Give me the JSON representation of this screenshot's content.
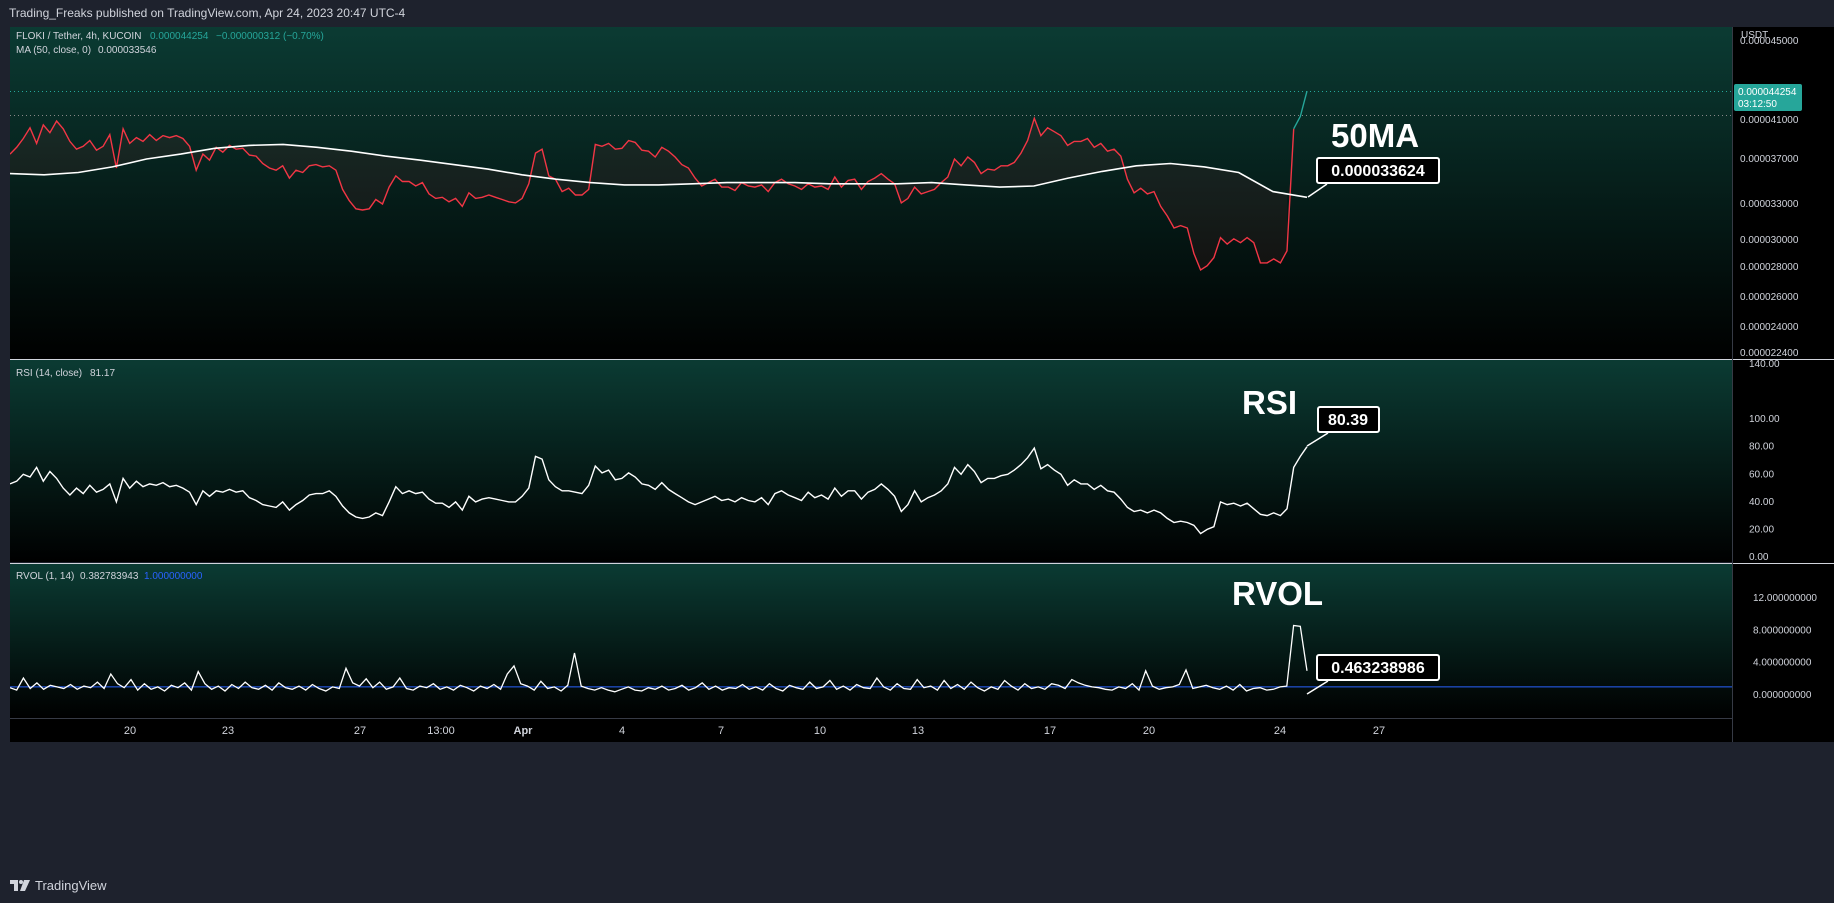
{
  "header": {
    "publisher": "Trading_Freaks published on TradingView.com, Apr 24, 2023 20:47 UTC-4"
  },
  "footer": {
    "brand": "TradingView"
  },
  "price_axis_unit": "USDT",
  "price_pane": {
    "symbol": "FLOKI / Tether, 4h, KUCOIN",
    "last": "0.000044254",
    "change": "−0.000000312 (−0.70%)",
    "ma_title": "MA (50, close, 0)",
    "ma_value": "0.000033546",
    "annotation_label": "50MA",
    "annotation_value": "0.000033624",
    "last_price_tag": "0.000044254",
    "countdown_tag": "03:12:50",
    "axis_ticks": [
      "0.000045000",
      "0.000041000",
      "0.000037000",
      "0.000033000",
      "0.000030000",
      "0.000028000",
      "0.000026000",
      "0.000024000",
      "0.000022400"
    ]
  },
  "rsi_pane": {
    "title": "RSI (14, close)",
    "value": "81.17",
    "annotation_label": "RSI",
    "annotation_value": "80.39",
    "axis_ticks": [
      "140.00",
      "100.00",
      "80.00",
      "60.00",
      "40.00",
      "20.00",
      "0.00"
    ]
  },
  "rvol_pane": {
    "title": "RVOL (1, 14)",
    "value": "0.382783943",
    "value2": "1.000000000",
    "annotation_label": "RVOL",
    "annotation_value": "0.463238986",
    "axis_ticks": [
      "12.000000000",
      "8.000000000",
      "4.000000000",
      "0.000000000"
    ]
  },
  "time_axis": [
    "20",
    "23",
    "27",
    "13:00",
    "Apr",
    "4",
    "7",
    "10",
    "13",
    "17",
    "20",
    "24",
    "27"
  ],
  "colors": {
    "down": "#f23645",
    "up": "#26a69a",
    "ma": "#ffffff",
    "rsi": "#ffffff",
    "rvol": "#ffffff",
    "rvol_baseline": "#2962ff",
    "bg_top": "#0b3b33",
    "bg_bottom": "#000000"
  },
  "chart_data": [
    {
      "type": "line",
      "title": "FLOKI / Tether, 4h, KUCOIN",
      "ylim": [
        2.24e-05,
        5.05e-05
      ],
      "series": [
        {
          "name": "FLOKI / Tether",
          "values": [
            3.75e-05,
            3.82e-05,
            3.91e-05,
            4.02e-05,
            3.86e-05,
            4.05e-05,
            3.97e-05,
            4.09e-05,
            4.01e-05,
            3.88e-05,
            3.8e-05,
            3.83e-05,
            3.89e-05,
            3.79e-05,
            3.83e-05,
            3.95e-05,
            3.62e-05,
            4.01e-05,
            3.86e-05,
            3.92e-05,
            3.88e-05,
            3.95e-05,
            3.89e-05,
            3.94e-05,
            3.92e-05,
            3.94e-05,
            3.91e-05,
            3.83e-05,
            3.6e-05,
            3.75e-05,
            3.69e-05,
            3.82e-05,
            3.77e-05,
            3.84e-05,
            3.8e-05,
            3.81e-05,
            3.74e-05,
            3.73e-05,
            3.66e-05,
            3.62e-05,
            3.6e-05,
            3.64e-05,
            3.53e-05,
            3.6e-05,
            3.58e-05,
            3.64e-05,
            3.65e-05,
            3.63e-05,
            3.64e-05,
            3.6e-05,
            3.43e-05,
            3.33e-05,
            3.26e-05,
            3.25e-05,
            3.26e-05,
            3.34e-05,
            3.3e-05,
            3.45e-05,
            3.55e-05,
            3.5e-05,
            3.5e-05,
            3.46e-05,
            3.49e-05,
            3.39e-05,
            3.35e-05,
            3.36e-05,
            3.32e-05,
            3.35e-05,
            3.28e-05,
            3.4e-05,
            3.35e-05,
            3.36e-05,
            3.38e-05,
            3.36e-05,
            3.34e-05,
            3.32e-05,
            3.31e-05,
            3.35e-05,
            3.48e-05,
            3.76e-05,
            3.8e-05,
            3.55e-05,
            3.52e-05,
            3.41e-05,
            3.44e-05,
            3.38e-05,
            3.38e-05,
            3.43e-05,
            3.85e-05,
            3.83e-05,
            3.86e-05,
            3.8e-05,
            3.81e-05,
            3.89e-05,
            3.87e-05,
            3.79e-05,
            3.78e-05,
            3.72e-05,
            3.82e-05,
            3.78e-05,
            3.72e-05,
            3.65e-05,
            3.62e-05,
            3.53e-05,
            3.46e-05,
            3.49e-05,
            3.52e-05,
            3.45e-05,
            3.45e-05,
            3.42e-05,
            3.49e-05,
            3.46e-05,
            3.45e-05,
            3.47e-05,
            3.41e-05,
            3.49e-05,
            3.52e-05,
            3.48e-05,
            3.46e-05,
            3.43e-05,
            3.48e-05,
            3.45e-05,
            3.46e-05,
            3.43e-05,
            3.54e-05,
            3.45e-05,
            3.51e-05,
            3.52e-05,
            3.43e-05,
            3.5e-05,
            3.53e-05,
            3.57e-05,
            3.52e-05,
            3.48e-05,
            3.31e-05,
            3.35e-05,
            3.45e-05,
            3.39e-05,
            3.41e-05,
            3.43e-05,
            3.49e-05,
            3.54e-05,
            3.7e-05,
            3.64e-05,
            3.72e-05,
            3.67e-05,
            3.57e-05,
            3.61e-05,
            3.6e-05,
            3.64e-05,
            3.64e-05,
            3.67e-05,
            3.76e-05,
            3.89e-05,
            4.12e-05,
            3.94e-05,
            4.02e-05,
            3.98e-05,
            3.94e-05,
            3.84e-05,
            3.88e-05,
            3.88e-05,
            3.91e-05,
            3.82e-05,
            3.86e-05,
            3.78e-05,
            3.8e-05,
            3.73e-05,
            3.52e-05,
            3.4e-05,
            3.44e-05,
            3.39e-05,
            3.41e-05,
            3.28e-05,
            3.2e-05,
            3.1e-05,
            3.12e-05,
            3.1e-05,
            2.9e-05,
            2.78e-05,
            2.81e-05,
            2.87e-05,
            3.02e-05,
            2.97e-05,
            3.01e-05,
            2.98e-05,
            3.02e-05,
            2.98e-05,
            2.83e-05,
            2.83e-05,
            2.86e-05,
            2.83e-05,
            2.92e-05,
            4.01e-05,
            4.14e-05,
            4.43e-05
          ]
        },
        {
          "name": "MA (50, close, 0)",
          "values": [
            3.57e-05,
            3.56e-05,
            3.58e-05,
            3.63e-05,
            3.7e-05,
            3.75e-05,
            3.81e-05,
            3.84e-05,
            3.85e-05,
            3.82e-05,
            3.78e-05,
            3.73e-05,
            3.69e-05,
            3.65e-05,
            3.61e-05,
            3.56e-05,
            3.52e-05,
            3.49e-05,
            3.47e-05,
            3.47e-05,
            3.48e-05,
            3.49e-05,
            3.49e-05,
            3.49e-05,
            3.48e-05,
            3.48e-05,
            3.48e-05,
            3.49e-05,
            3.47e-05,
            3.45e-05,
            3.46e-05,
            3.53e-05,
            3.59e-05,
            3.64e-05,
            3.66e-05,
            3.63e-05,
            3.58e-05,
            3.41e-05,
            3.36e-05
          ]
        }
      ]
    },
    {
      "type": "line",
      "title": "RSI (14, close)",
      "ylim": [
        0,
        140
      ],
      "series": [
        {
          "name": "RSI (14, close)",
          "values": [
            53,
            55,
            60,
            58,
            65,
            55,
            62,
            57,
            50,
            45,
            50,
            46,
            52,
            47,
            49,
            53,
            40,
            57,
            50,
            55,
            51,
            53,
            52,
            54,
            51,
            52,
            50,
            47,
            38,
            48,
            44,
            48,
            47,
            49,
            47,
            48,
            43,
            41,
            38,
            37,
            36,
            40,
            34,
            38,
            41,
            45,
            46,
            46,
            48,
            44,
            37,
            32,
            29,
            28,
            29,
            32,
            30,
            40,
            51,
            46,
            48,
            46,
            47,
            42,
            39,
            39,
            36,
            40,
            34,
            44,
            40,
            42,
            43,
            42,
            41,
            40,
            40,
            44,
            50,
            73,
            71,
            56,
            51,
            48,
            48,
            47,
            46,
            52,
            66,
            61,
            63,
            56,
            57,
            61,
            58,
            53,
            52,
            49,
            54,
            49,
            46,
            43,
            40,
            38,
            40,
            42,
            44,
            41,
            42,
            40,
            43,
            41,
            40,
            43,
            38,
            46,
            48,
            45,
            43,
            41,
            47,
            43,
            45,
            42,
            50,
            44,
            48,
            48,
            42,
            47,
            49,
            53,
            49,
            44,
            33,
            38,
            48,
            40,
            43,
            45,
            48,
            53,
            65,
            60,
            67,
            62,
            54,
            57,
            57,
            59,
            60,
            63,
            67,
            72,
            79,
            64,
            67,
            63,
            60,
            52,
            56,
            53,
            53,
            49,
            52,
            48,
            47,
            42,
            36,
            33,
            34,
            32,
            34,
            32,
            28,
            25,
            26,
            25,
            23,
            17,
            20,
            22,
            40,
            38,
            39,
            37,
            39,
            35,
            31,
            30,
            32,
            30,
            35,
            65,
            73,
            80
          ]
        }
      ]
    },
    {
      "type": "line",
      "title": "RVOL (1, 14)",
      "ylim": [
        -1.5,
        13.5
      ],
      "series": [
        {
          "name": "RVOL (1, 14)",
          "values": [
            0.9,
            0.6,
            2.1,
            0.8,
            1.5,
            0.7,
            1.2,
            1.0,
            0.8,
            1.3,
            0.7,
            1.1,
            0.9,
            1.6,
            0.8,
            2.6,
            1.4,
            0.9,
            1.9,
            0.6,
            1.4,
            0.7,
            1.0,
            0.5,
            1.2,
            0.9,
            1.5,
            0.6,
            2.9,
            1.4,
            0.7,
            1.1,
            0.5,
            1.3,
            0.8,
            1.6,
            0.9,
            0.7,
            1.2,
            0.6,
            1.5,
            0.9,
            0.7,
            1.1,
            0.6,
            1.3,
            0.8,
            0.5,
            1.0,
            0.8,
            3.3,
            1.5,
            1.1,
            2.0,
            0.9,
            1.6,
            0.7,
            1.0,
            2.1,
            0.8,
            0.6,
            1.1,
            0.9,
            1.4,
            0.7,
            1.0,
            0.6,
            1.2,
            0.9,
            0.5,
            1.1,
            0.8,
            1.3,
            0.7,
            2.6,
            3.6,
            1.4,
            1.1,
            0.6,
            1.7,
            0.8,
            1.0,
            0.5,
            1.2,
            5.2,
            1.1,
            0.8,
            0.6,
            0.9,
            0.6,
            0.4,
            0.7,
            1.0,
            0.6,
            0.5,
            0.9,
            0.7,
            1.1,
            0.6,
            0.8,
            1.2,
            0.6,
            0.9,
            1.5,
            0.7,
            1.1,
            0.6,
            0.9,
            0.8,
            1.3,
            0.7,
            1.0,
            0.6,
            1.4,
            0.8,
            0.5,
            1.2,
            0.9,
            0.7,
            1.6,
            0.8,
            1.0,
            1.8,
            0.7,
            1.1,
            0.6,
            1.3,
            0.9,
            0.8,
            2.1,
            1.0,
            0.6,
            1.4,
            0.8,
            0.7,
            1.9,
            0.9,
            1.1,
            0.6,
            1.8,
            0.8,
            1.3,
            0.7,
            1.6,
            0.9,
            0.5,
            1.0,
            0.7,
            1.8,
            1.1,
            0.6,
            1.4,
            0.8,
            1.0,
            0.7,
            1.4,
            1.2,
            0.8,
            1.9,
            1.5,
            1.2,
            1.0,
            0.9,
            0.7,
            0.6,
            1.0,
            0.8,
            1.4,
            0.6,
            3.0,
            1.1,
            0.7,
            0.9,
            1.0,
            1.3,
            3.1,
            0.8,
            1.0,
            1.2,
            0.9,
            0.7,
            1.1,
            0.6,
            1.3,
            0.5,
            0.8,
            0.9,
            0.6,
            0.7,
            1.0,
            1.1,
            8.6,
            8.5,
            3.0
          ]
        }
      ]
    }
  ]
}
